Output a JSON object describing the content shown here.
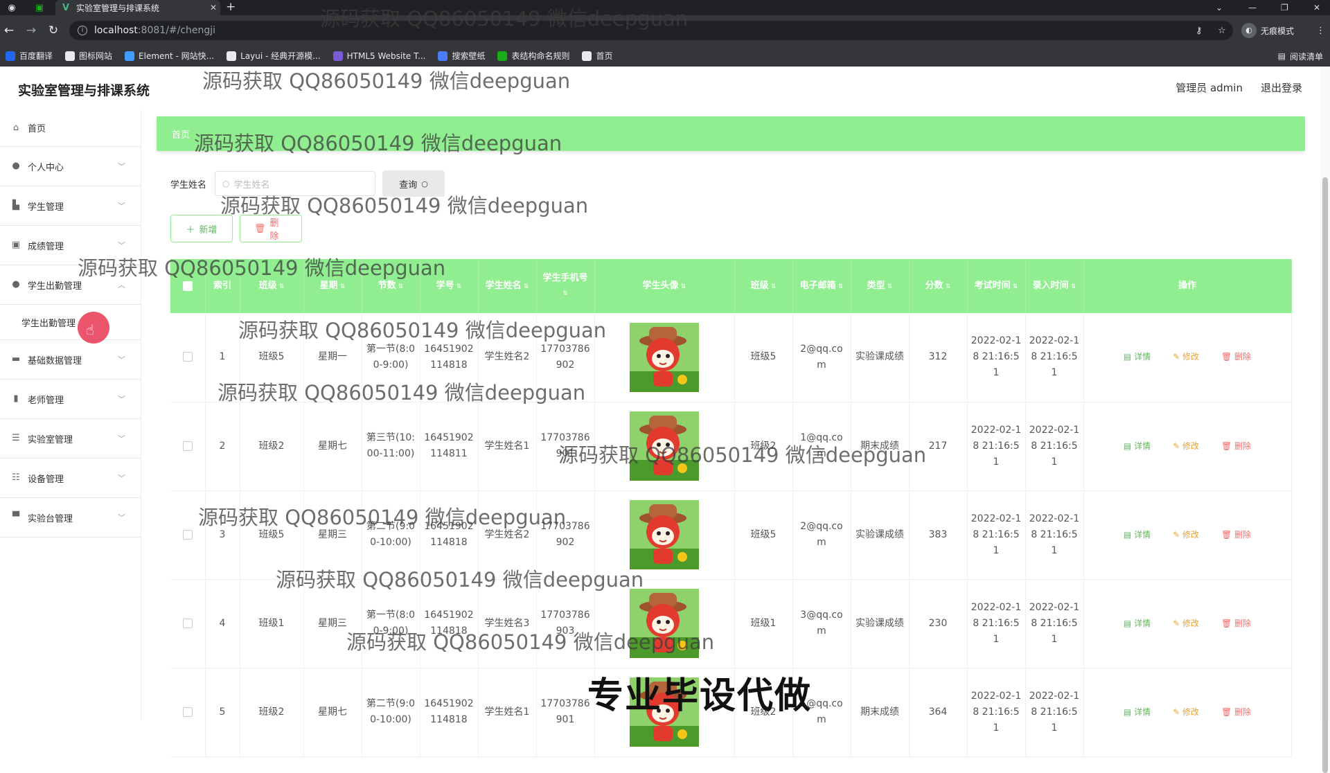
{
  "browser": {
    "tab_title": "实验室管理与排课系统",
    "url_host": "localhost",
    "url_path": ":8081/#/chengji",
    "incognito_label": "无痕模式",
    "reading_list_label": "阅读清单",
    "bookmarks": [
      {
        "label": "百度翻译",
        "color": "#2468f2"
      },
      {
        "label": "图标网站",
        "color": "#e8eaed"
      },
      {
        "label": "Element - 网站快...",
        "color": "#409eff"
      },
      {
        "label": "Layui - 经典开源模...",
        "color": "#e8eaed"
      },
      {
        "label": "HTML5 Website T...",
        "color": "#7b5cd6"
      },
      {
        "label": "搜索壁纸",
        "color": "#4a7cf7"
      },
      {
        "label": "表结构命名规则",
        "color": "#1aad19"
      },
      {
        "label": "首页",
        "color": "#e8eaed"
      }
    ]
  },
  "app": {
    "title": "实验室管理与排课系统",
    "user_label": "管理员 admin",
    "logout_label": "退出登录"
  },
  "sidebar": {
    "items": [
      {
        "label": "首页",
        "icon": "home-icon",
        "glyph": "⌂"
      },
      {
        "label": "个人中心",
        "icon": "user-icon",
        "glyph": "●"
      },
      {
        "label": "学生管理",
        "icon": "chart-icon",
        "glyph": "▙"
      },
      {
        "label": "成绩管理",
        "icon": "clipboard-icon",
        "glyph": "▣"
      },
      {
        "label": "学生出勤管理",
        "icon": "user-icon",
        "glyph": "●"
      },
      {
        "label": "基础数据管理",
        "icon": "card-icon",
        "glyph": "▬"
      },
      {
        "label": "老师管理",
        "icon": "bar-icon",
        "glyph": "▮"
      },
      {
        "label": "实验室管理",
        "icon": "list-icon",
        "glyph": "☰"
      },
      {
        "label": "设备管理",
        "icon": "sliders-icon",
        "glyph": "☷"
      },
      {
        "label": "实验台管理",
        "icon": "monitor-icon",
        "glyph": "▀"
      }
    ],
    "submenu_label": "学生出勤管理"
  },
  "breadcrumb": {
    "home": "首页"
  },
  "search": {
    "label": "学生姓名",
    "placeholder": "学生姓名",
    "button": "查询"
  },
  "actions": {
    "add": "新增",
    "delete": "删除"
  },
  "table": {
    "headers": [
      "索引",
      "班级",
      "星期",
      "节数",
      "学号",
      "学生姓名",
      "学生手机号",
      "学生头像",
      "班级",
      "电子邮箱",
      "类型",
      "分数",
      "考试时间",
      "录入时间",
      "操作"
    ],
    "op_labels": {
      "detail": "详情",
      "edit": "修改",
      "remove": "删除"
    },
    "rows": [
      {
        "index": "1",
        "class": "班级5",
        "weekday": "星期一",
        "section": "第一节(8:00-9:00)",
        "student_no": "16451902114818",
        "name": "学生姓名2",
        "phone": "17703786902",
        "class2": "班级5",
        "email": "2@qq.com",
        "type": "实验课成绩",
        "score": "312",
        "exam_time": "2022-02-18 21:16:51",
        "entry_time": "2022-02-18 21:16:51"
      },
      {
        "index": "2",
        "class": "班级2",
        "weekday": "星期七",
        "section": "第三节(10:00-11:00)",
        "student_no": "16451902114811",
        "name": "学生姓名1",
        "phone": "17703786901",
        "class2": "班级2",
        "email": "1@qq.com",
        "type": "期末成绩",
        "score": "217",
        "exam_time": "2022-02-18 21:16:51",
        "entry_time": "2022-02-18 21:16:51"
      },
      {
        "index": "3",
        "class": "班级5",
        "weekday": "星期三",
        "section": "第二节(9:00-10:00)",
        "student_no": "16451902114818",
        "name": "学生姓名2",
        "phone": "17703786902",
        "class2": "班级5",
        "email": "2@qq.com",
        "type": "实验课成绩",
        "score": "383",
        "exam_time": "2022-02-18 21:16:51",
        "entry_time": "2022-02-18 21:16:51"
      },
      {
        "index": "4",
        "class": "班级1",
        "weekday": "星期三",
        "section": "第一节(8:00-9:00)",
        "student_no": "16451902114818",
        "name": "学生姓名3",
        "phone": "17703786903",
        "class2": "班级1",
        "email": "3@qq.com",
        "type": "实验课成绩",
        "score": "230",
        "exam_time": "2022-02-18 21:16:51",
        "entry_time": "2022-02-18 21:16:51"
      },
      {
        "index": "5",
        "class": "班级2",
        "weekday": "星期七",
        "section": "第二节(9:00-10:00)",
        "student_no": "16451902114818",
        "name": "学生姓名1",
        "phone": "17703786901",
        "class2": "班级2",
        "email": "1@qq.com",
        "type": "期末成绩",
        "score": "364",
        "exam_time": "2022-02-18 21:16:51",
        "entry_time": "2022-02-18 21:16:51"
      }
    ]
  },
  "overlay": {
    "watermark": "源码获取 QQ86050149 微信deepguan",
    "banner": "专业毕设代做"
  },
  "colors": {
    "accent": "#90ee90",
    "header_text": "#ffffff",
    "danger": "#f56c6c",
    "warning": "#e6a23c",
    "success": "#5cb85c"
  }
}
